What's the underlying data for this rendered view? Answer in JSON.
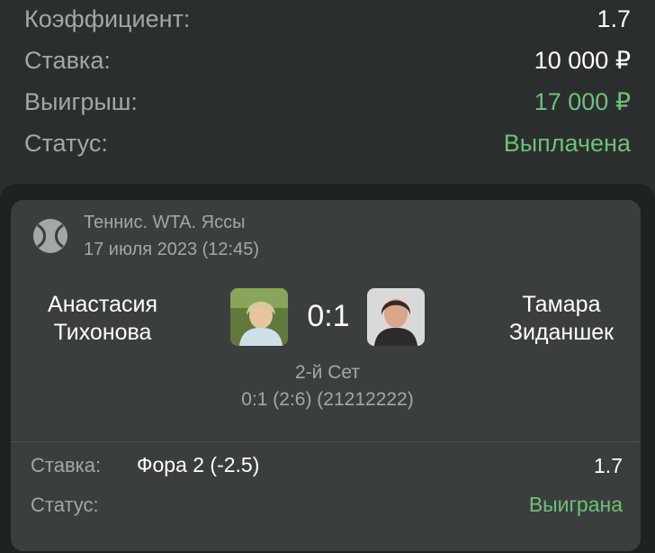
{
  "summary": {
    "coef_label": "Коэффициент:",
    "coef_value": "1.7",
    "stake_label": "Ставка:",
    "stake_value": "10 000 ₽",
    "win_label": "Выигрыш:",
    "win_value": "17 000 ₽",
    "status_label": "Статус:",
    "status_value": "Выплачена"
  },
  "event": {
    "tournament": "Теннис. WTA. Яссы",
    "date": "17 июля 2023 (12:45)",
    "player1_line1": "Анастасия",
    "player1_line2": "Тихонова",
    "player2_line1": "Тамара",
    "player2_line2": "Зиданшек",
    "score": "0:1",
    "set": "2-й Сет",
    "set_score": "0:1 (2:6) (21212222)"
  },
  "bet": {
    "label": "Ставка:",
    "market": "Фора 2 (-2.5)",
    "coef": "1.7",
    "status_label": "Статус:",
    "status_value": "Выиграна"
  },
  "icons": {
    "sport": "tennis-ball-icon",
    "player1": "player1-avatar",
    "player2": "player2-avatar"
  },
  "colors": {
    "green": "#6fc07a",
    "muted": "#a2a7a7",
    "bg": "#2b2e2e",
    "card": "#3a3e3e"
  }
}
